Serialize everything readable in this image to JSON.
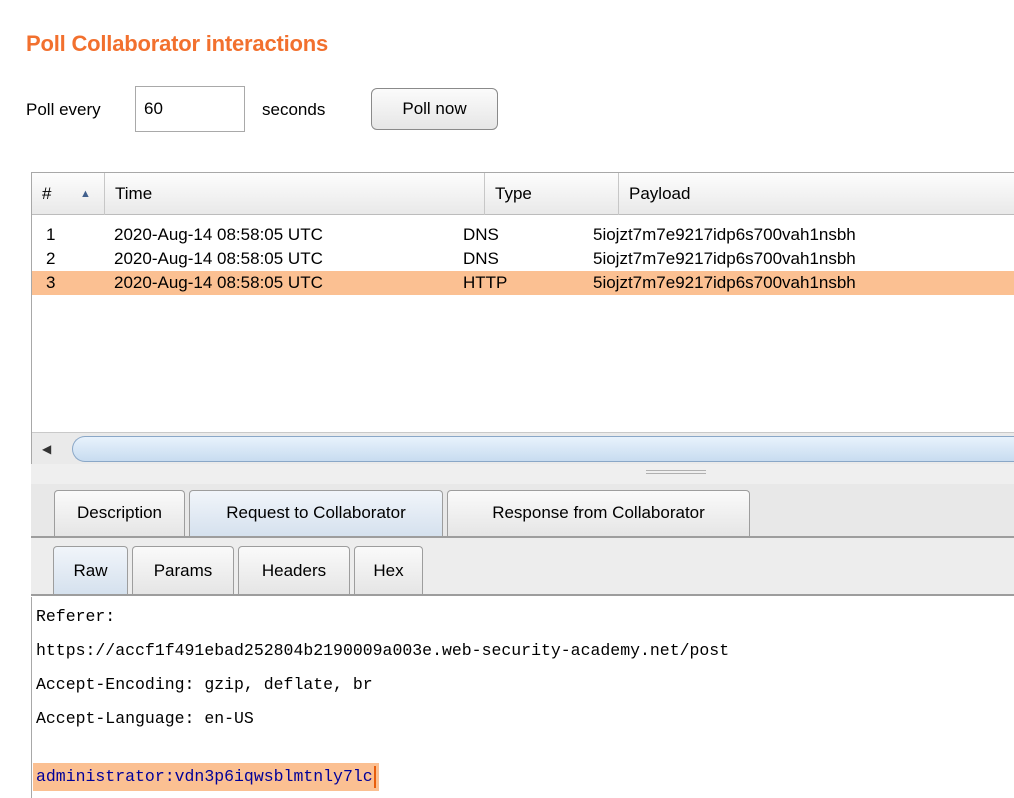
{
  "panel": {
    "title": "Poll Collaborator interactions",
    "poll_every_label": "Poll every",
    "poll_interval_value": "60",
    "seconds_label": "seconds",
    "poll_now_label": "Poll now"
  },
  "table": {
    "columns": [
      "#",
      "Time",
      "Type",
      "Payload"
    ],
    "sort_indicator": "▲",
    "rows": [
      {
        "num": "1",
        "time": "2020-Aug-14 08:58:05 UTC",
        "type": "DNS",
        "payload": "5iojzt7m7e9217idp6s700vah1nsbh"
      },
      {
        "num": "2",
        "time": "2020-Aug-14 08:58:05 UTC",
        "type": "DNS",
        "payload": "5iojzt7m7e9217idp6s700vah1nsbh"
      },
      {
        "num": "3",
        "time": "2020-Aug-14 08:58:05 UTC",
        "type": "HTTP",
        "payload": "5iojzt7m7e9217idp6s700vah1nsbh"
      }
    ],
    "selected_row": 3
  },
  "detail_tabs": {
    "items": [
      "Description",
      "Request to Collaborator",
      "Response from Collaborator"
    ],
    "active": "Request to Collaborator"
  },
  "view_tabs": {
    "items": [
      "Raw",
      "Params",
      "Headers",
      "Hex"
    ],
    "active": "Raw"
  },
  "editor": {
    "lines": [
      "Referer:",
      "https://accf1f491ebad252804b2190009a003e.web-security-academy.net/post",
      "Accept-Encoding: gzip, deflate, br",
      "Accept-Language: en-US"
    ],
    "highlighted_line": "administrator:vdn3p6iqwsblmtnly7lc"
  },
  "colors": {
    "title": "#f2702e",
    "selection": "#fbc092",
    "highlight_text": "#000099"
  }
}
